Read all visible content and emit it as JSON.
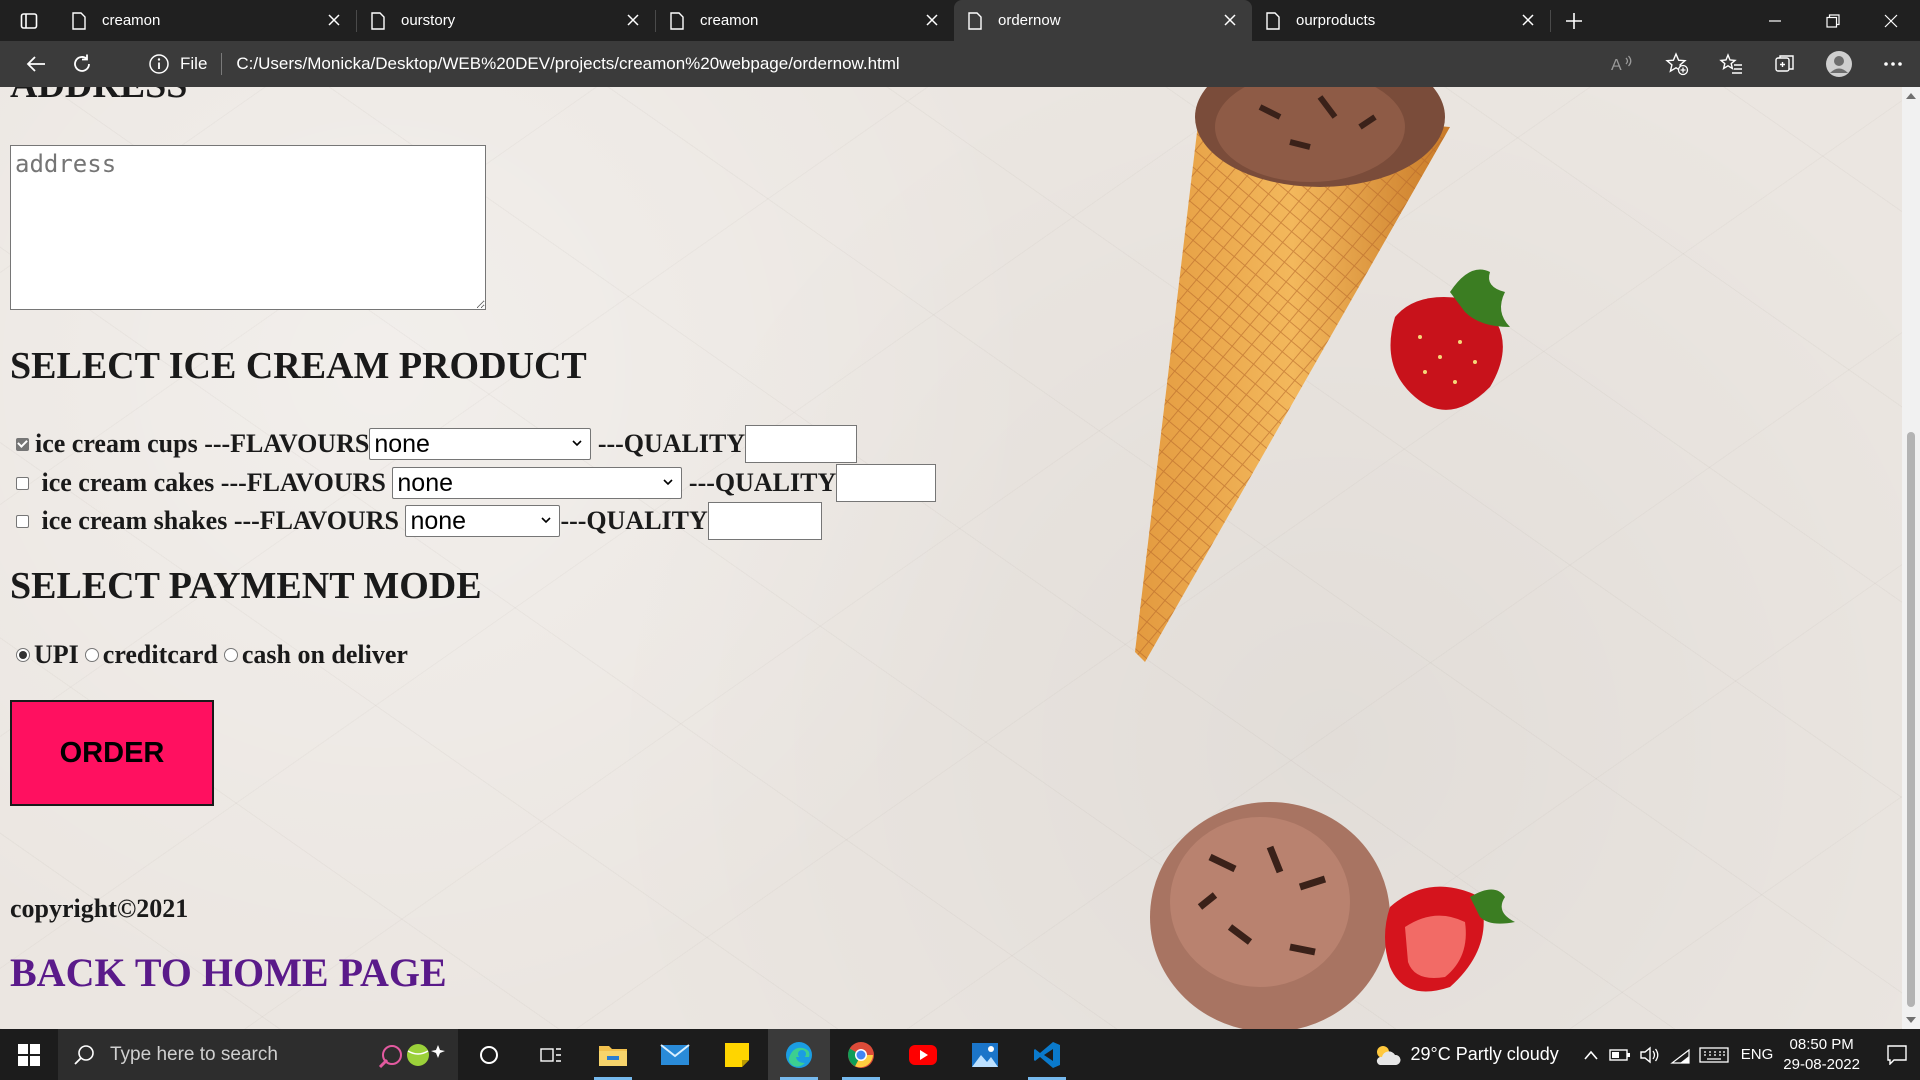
{
  "browser": {
    "tabs": [
      {
        "title": "creamon",
        "active": false
      },
      {
        "title": "ourstory",
        "active": false
      },
      {
        "title": "creamon",
        "active": false
      },
      {
        "title": "ordernow",
        "active": true
      },
      {
        "title": "ourproducts",
        "active": false
      }
    ],
    "address": {
      "scheme_label": "File",
      "url": "C:/Users/Monicka/Desktop/WEB%20DEV/projects/creamon%20webpage/ordernow.html"
    }
  },
  "page": {
    "address_heading": "ADDRESS",
    "address_placeholder": "address",
    "product_heading": "SELECT ICE CREAM PRODUCT",
    "products": [
      {
        "name": "ice cream cups",
        "flavours_label": "---FLAVOURS",
        "selected_flavour": "none",
        "quality_label": "---QUALITY",
        "checked": true
      },
      {
        "name": "ice cream cakes",
        "flavours_label": "---FLAVOURS",
        "selected_flavour": "none",
        "quality_label": "---QUALITY",
        "checked": false
      },
      {
        "name": "ice cream shakes",
        "flavours_label": "---FLAVOURS",
        "selected_flavour": "none",
        "quality_label": "---QUALITY",
        "checked": false
      }
    ],
    "payment_heading": "SELECT PAYMENT MODE",
    "payment_options": [
      {
        "label": "UPI",
        "selected": true
      },
      {
        "label": "creditcard",
        "selected": false
      },
      {
        "label": "cash on deliver",
        "selected": false
      }
    ],
    "order_button": "ORDER",
    "copyright": "copyright©2021",
    "back_link": "BACK TO HOME PAGE"
  },
  "taskbar": {
    "search_placeholder": "Type here to search",
    "weather": "29°C  Partly cloudy",
    "language": "ENG",
    "time": "08:50 PM",
    "date": "29-08-2022"
  },
  "colors": {
    "order_button": "#ff1060",
    "link": "#5a1a8a",
    "page_bg": "#ebe6e1"
  }
}
